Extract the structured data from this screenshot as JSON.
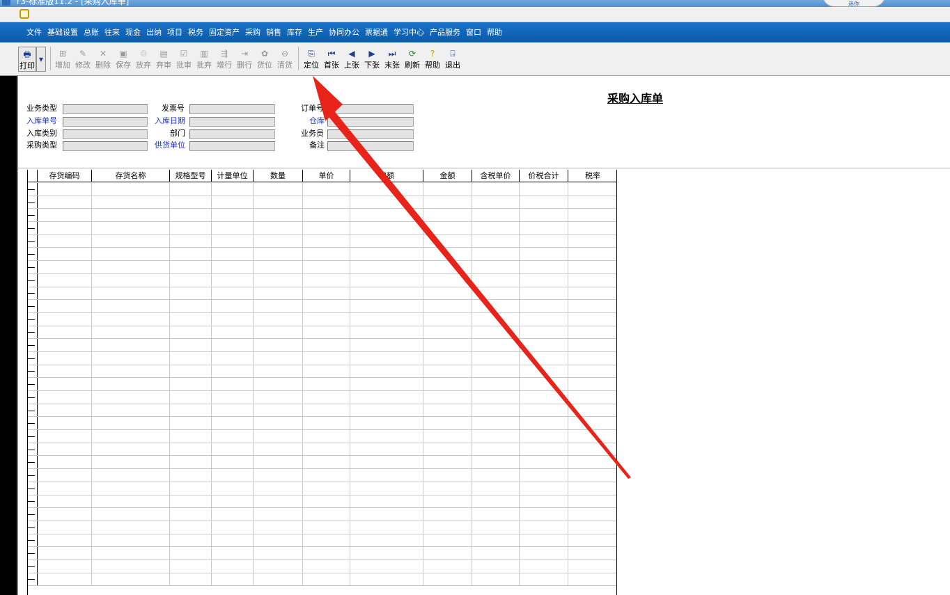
{
  "window": {
    "title": "T3-标准版11.2 - [采购入库单]",
    "logo_text": "迷你"
  },
  "menu": [
    "文件",
    "基础设置",
    "总账",
    "往来",
    "现金",
    "出纳",
    "项目",
    "税务",
    "固定资产",
    "采购",
    "销售",
    "库存",
    "生产",
    "协同办公",
    "票据通",
    "学习中心",
    "产品服务",
    "窗口",
    "帮助"
  ],
  "toolbar": {
    "print": "打印",
    "add": "增加",
    "edit": "修改",
    "delete": "删除",
    "save": "保存",
    "abandon": "放弃",
    "unapprove": "弃审",
    "approve": "批审",
    "batch_abandon": "批弃",
    "add_row": "增行",
    "del_row": "删行",
    "location": "货位",
    "clear": "清货",
    "locate": "定位",
    "first": "首张",
    "prev": "上张",
    "next": "下张",
    "last": "末张",
    "refresh": "刷新",
    "help": "帮助",
    "exit": "退出"
  },
  "form": {
    "title": "采购入库单",
    "labels": {
      "business_type": "业务类型",
      "receipt_no": "入库单号",
      "receipt_category": "入库类别",
      "purchase_type": "采购类型",
      "invoice_no": "发票号",
      "receipt_date": "入库日期",
      "department": "部门",
      "supplier": "供货单位",
      "order_no": "订单号",
      "warehouse": "仓库",
      "salesperson": "业务员",
      "remark": "备注"
    },
    "values": {
      "business_type": "",
      "receipt_no": "",
      "receipt_category": "",
      "purchase_type": "",
      "invoice_no": "",
      "receipt_date": "",
      "department": "",
      "supplier": "",
      "order_no": "",
      "warehouse": "",
      "salesperson": "",
      "remark": ""
    }
  },
  "grid": {
    "columns": [
      "存货编码",
      "存货名称",
      "规格型号",
      "计量单位",
      "数量",
      "单价",
      "税额",
      "金额",
      "含税单价",
      "价税合计",
      "税率"
    ],
    "row_count": 31
  },
  "colors": {
    "menubar": "#0a5aa8",
    "required_label": "#1a2fcf",
    "annotation_arrow": "#e8231a"
  }
}
